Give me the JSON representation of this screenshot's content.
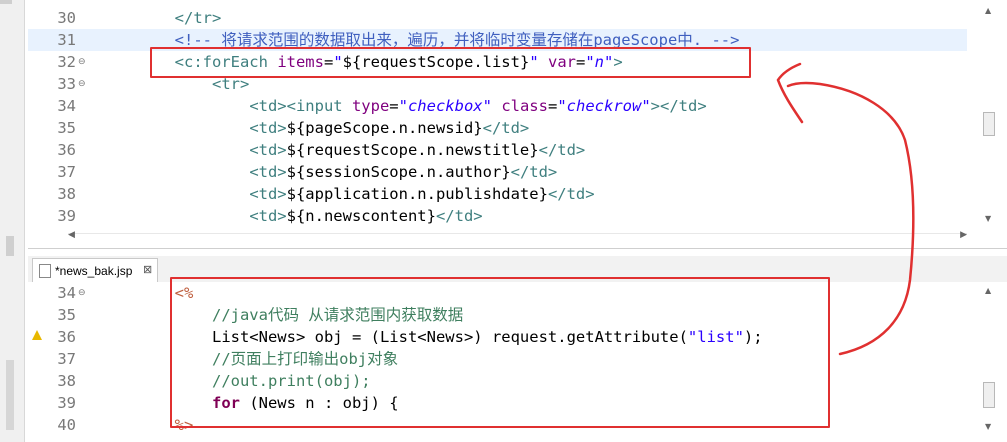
{
  "top_editor": {
    "lines": [
      {
        "num": "30",
        "fold": "",
        "segments": [
          {
            "t": "        ",
            "c": "txt"
          },
          {
            "t": "</tr>",
            "c": "tag"
          }
        ]
      },
      {
        "num": "31",
        "fold": "",
        "highlight": true,
        "segments": [
          {
            "t": "        ",
            "c": "txt"
          },
          {
            "t": "<!-- 将请求范围的数据取出来，遍历，并将临时变量存储在pageScope中. -->",
            "c": "cmt"
          }
        ]
      },
      {
        "num": "32",
        "fold": "⊖",
        "segments": [
          {
            "t": "        ",
            "c": "txt"
          },
          {
            "t": "<c:forEach ",
            "c": "tag"
          },
          {
            "t": "items",
            "c": "attr"
          },
          {
            "t": "=",
            "c": "txt"
          },
          {
            "t": "\"",
            "c": "strn"
          },
          {
            "t": "${requestScope.list}",
            "c": "txt"
          },
          {
            "t": "\"",
            "c": "strn"
          },
          {
            "t": " ",
            "c": "txt"
          },
          {
            "t": "var",
            "c": "attr"
          },
          {
            "t": "=",
            "c": "txt"
          },
          {
            "t": "\"n\"",
            "c": "str"
          },
          {
            "t": ">",
            "c": "tag"
          }
        ]
      },
      {
        "num": "33",
        "fold": "⊖",
        "segments": [
          {
            "t": "            ",
            "c": "txt"
          },
          {
            "t": "<tr>",
            "c": "tag"
          }
        ]
      },
      {
        "num": "34",
        "fold": "",
        "segments": [
          {
            "t": "                ",
            "c": "txt"
          },
          {
            "t": "<td><input ",
            "c": "tag"
          },
          {
            "t": "type",
            "c": "attr"
          },
          {
            "t": "=",
            "c": "txt"
          },
          {
            "t": "\"checkbox\"",
            "c": "str"
          },
          {
            "t": " ",
            "c": "txt"
          },
          {
            "t": "class",
            "c": "attr"
          },
          {
            "t": "=",
            "c": "txt"
          },
          {
            "t": "\"checkrow\"",
            "c": "str"
          },
          {
            "t": "></td>",
            "c": "tag"
          }
        ]
      },
      {
        "num": "35",
        "fold": "",
        "segments": [
          {
            "t": "                ",
            "c": "txt"
          },
          {
            "t": "<td>",
            "c": "tag"
          },
          {
            "t": "${pageScope.n.newsid}",
            "c": "txt"
          },
          {
            "t": "</td>",
            "c": "tag"
          }
        ]
      },
      {
        "num": "36",
        "fold": "",
        "segments": [
          {
            "t": "                ",
            "c": "txt"
          },
          {
            "t": "<td>",
            "c": "tag"
          },
          {
            "t": "${requestScope.n.newstitle}",
            "c": "txt"
          },
          {
            "t": "</td>",
            "c": "tag"
          }
        ]
      },
      {
        "num": "37",
        "fold": "",
        "segments": [
          {
            "t": "                ",
            "c": "txt"
          },
          {
            "t": "<td>",
            "c": "tag"
          },
          {
            "t": "${sessionScope.n.author}",
            "c": "txt"
          },
          {
            "t": "</td>",
            "c": "tag"
          }
        ]
      },
      {
        "num": "38",
        "fold": "",
        "segments": [
          {
            "t": "                ",
            "c": "txt"
          },
          {
            "t": "<td>",
            "c": "tag"
          },
          {
            "t": "${application.n.publishdate}",
            "c": "txt"
          },
          {
            "t": "</td>",
            "c": "tag"
          }
        ]
      },
      {
        "num": "39",
        "fold": "",
        "segments": [
          {
            "t": "                ",
            "c": "txt"
          },
          {
            "t": "<td>",
            "c": "tag"
          },
          {
            "t": "${n.newscontent}",
            "c": "txt"
          },
          {
            "t": "</td>",
            "c": "tag"
          }
        ]
      }
    ]
  },
  "tab": {
    "label": "*news_bak.jsp",
    "close": "⊠"
  },
  "bottom_editor": {
    "lines": [
      {
        "num": "34",
        "fold": "⊖",
        "segments": [
          {
            "t": "        ",
            "c": "txt"
          },
          {
            "t": "<%",
            "c": "scriptlet"
          }
        ]
      },
      {
        "num": "35",
        "fold": "",
        "segments": [
          {
            "t": "            ",
            "c": "txt"
          },
          {
            "t": "//java代码 从请求范围内获取数据",
            "c": "jcmt"
          }
        ]
      },
      {
        "num": "36",
        "fold": "",
        "warning": true,
        "segments": [
          {
            "t": "            ",
            "c": "txt"
          },
          {
            "t": "List<News> obj = (List<News>) request.getAttribute(",
            "c": "txt"
          },
          {
            "t": "\"list\"",
            "c": "strn"
          },
          {
            "t": ");",
            "c": "txt"
          }
        ]
      },
      {
        "num": "37",
        "fold": "",
        "segments": [
          {
            "t": "            ",
            "c": "txt"
          },
          {
            "t": "//页面上打印输出obj对象",
            "c": "jcmt"
          }
        ]
      },
      {
        "num": "38",
        "fold": "",
        "segments": [
          {
            "t": "            ",
            "c": "txt"
          },
          {
            "t": "//out.print(obj);",
            "c": "jcmt"
          }
        ]
      },
      {
        "num": "39",
        "fold": "",
        "segments": [
          {
            "t": "            ",
            "c": "txt"
          },
          {
            "t": "for",
            "c": "kw"
          },
          {
            "t": " (News n : obj) {",
            "c": "txt"
          }
        ]
      },
      {
        "num": "40",
        "fold": "",
        "segments": [
          {
            "t": "        ",
            "c": "txt"
          },
          {
            "t": "%>",
            "c": "scriptlet"
          }
        ]
      }
    ]
  },
  "scroll_arrows": {
    "up": "▲",
    "down": "▼",
    "left": "◀",
    "right": "▶"
  },
  "annotation_color": "#e03030"
}
